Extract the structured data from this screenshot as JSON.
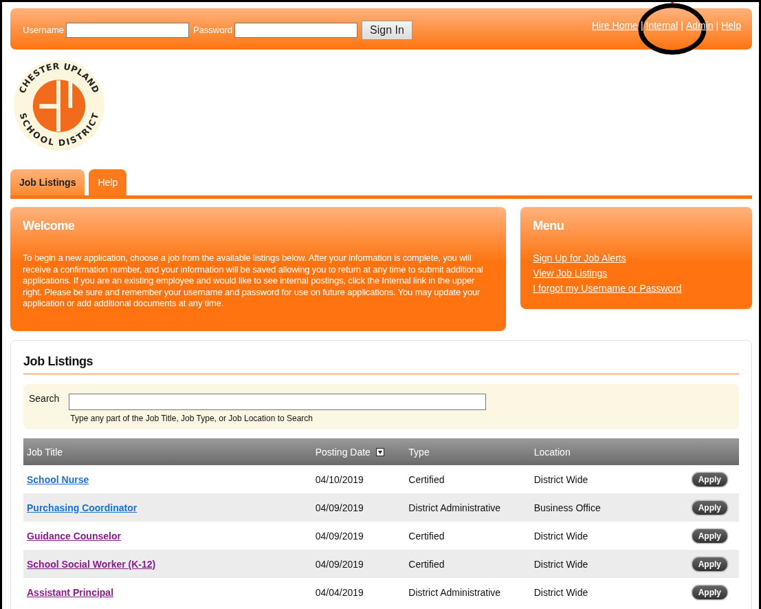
{
  "login": {
    "username_label": "Username",
    "password_label": "Password",
    "sign_in": "Sign In"
  },
  "top_links": [
    {
      "label": "Hire Home"
    },
    {
      "label": "Internal"
    },
    {
      "label": "Admin"
    },
    {
      "label": "Help"
    }
  ],
  "link_separator": "|",
  "annotation": {
    "kind": "circle"
  },
  "logo": {
    "top_text": "CHESTER UPLAND",
    "bottom_text": "SCHOOL DISTRICT"
  },
  "tabs": [
    {
      "label": "Job Listings",
      "selected": true
    },
    {
      "label": "Help",
      "selected": false
    }
  ],
  "welcome": {
    "title": "Welcome",
    "text": "To begin a new application, choose a job from the available listings below. After your information is complete, you will receive a confirmation number, and your information will be saved allowing you to return at any time to submit additional applications. If you are an existing employee and would like to see internal postings, click the Internal link in the upper right. Please be sure and remember your username and password for use on future applications. You may update your application or add additional documents at any time."
  },
  "menu": {
    "title": "Menu",
    "links": [
      "Sign Up for Job Alerts",
      "View Job Listings",
      "I forgot my Username or Password"
    ]
  },
  "job_listings": {
    "title": "Job Listings",
    "search_label": "Search",
    "search_hint": "Type any part of the Job Title, Job Type, or Job Location to Search",
    "columns": [
      "Job Title",
      "Posting Date",
      "Type",
      "Location"
    ],
    "rows": [
      {
        "title": "School Nurse",
        "visited": false,
        "date": "04/10/2019",
        "type": "Certified",
        "location": "District Wide",
        "action": "Apply"
      },
      {
        "title": "Purchasing Coordinator",
        "visited": false,
        "date": "04/09/2019",
        "type": "District Administrative",
        "location": "Business Office",
        "action": "Apply"
      },
      {
        "title": "Guidance Counselor",
        "visited": true,
        "date": "04/09/2019",
        "type": "Certified",
        "location": "District Wide",
        "action": "Apply"
      },
      {
        "title": "School Social Worker (K-12)",
        "visited": true,
        "date": "04/09/2019",
        "type": "Certified",
        "location": "District Wide",
        "action": "Apply"
      },
      {
        "title": "Assistant Principal",
        "visited": true,
        "date": "04/04/2019",
        "type": "District Administrative",
        "location": "District Wide",
        "action": "Apply"
      }
    ]
  }
}
